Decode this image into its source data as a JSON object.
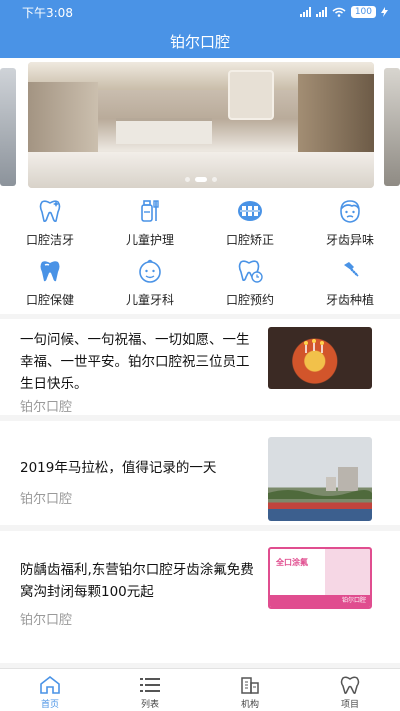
{
  "status_bar": {
    "time": "下午3:08",
    "battery": "100",
    "icons": [
      "signal-icon",
      "wifi-icon",
      "battery-icon",
      "charging-icon"
    ]
  },
  "header": {
    "title": "铂尔口腔"
  },
  "banner": {
    "slide_index": 2,
    "slide_count": 3
  },
  "categories": [
    {
      "label": "口腔洁牙",
      "icon": "tooth-clean-icon"
    },
    {
      "label": "儿童护理",
      "icon": "toothpaste-icon"
    },
    {
      "label": "口腔矫正",
      "icon": "braces-icon"
    },
    {
      "label": "牙齿异味",
      "icon": "face-odor-icon"
    },
    {
      "label": "口腔保健",
      "icon": "tooth-care-icon"
    },
    {
      "label": "儿童牙科",
      "icon": "child-face-icon"
    },
    {
      "label": "口腔预约",
      "icon": "tooth-clock-icon"
    },
    {
      "label": "牙齿种植",
      "icon": "implant-icon"
    }
  ],
  "articles": [
    {
      "title": "一句问候、一句祝福、一切如愿、一生幸福、一世平安。铂尔口腔祝三位员工生日快乐。",
      "source": "铂尔口腔",
      "thumb": "birthday-cake-image"
    },
    {
      "title": "2019年马拉松，值得记录的一天",
      "source": "铂尔口腔",
      "thumb": "marathon-crowd-image"
    },
    {
      "title": "防龋齿福利,东营铂尔口腔牙齿涂氟免费窝沟封闭每颗100元起",
      "source": "铂尔口腔",
      "thumb": "fluoride-promo-image",
      "thumb_text": "全口涂氟",
      "thumb_footer": "铂尔口腔"
    }
  ],
  "tabs": [
    {
      "label": "首页",
      "icon": "home-icon",
      "active": true
    },
    {
      "label": "列表",
      "icon": "list-icon",
      "active": false
    },
    {
      "label": "机构",
      "icon": "building-icon",
      "active": false
    },
    {
      "label": "项目",
      "icon": "tooth-icon",
      "active": false
    }
  ],
  "colors": {
    "accent": "#4a93e6",
    "background": "#f4f4f4",
    "promo": "#e04d8f"
  }
}
